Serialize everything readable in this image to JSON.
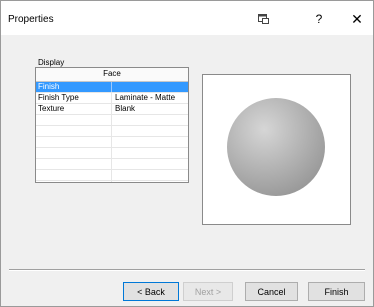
{
  "window": {
    "title": "Properties"
  },
  "titlebar": {
    "help_glyph": "?",
    "close_glyph": "✕"
  },
  "display": {
    "label": "Display",
    "column_header": "Face",
    "rows": [
      {
        "name": "Finish",
        "value": "",
        "selected": true
      },
      {
        "name": "Finish Type",
        "value": "Laminate - Matte",
        "selected": false
      },
      {
        "name": "Texture",
        "value": "Blank",
        "selected": false
      },
      {
        "name": "",
        "value": "",
        "selected": false
      },
      {
        "name": "",
        "value": "",
        "selected": false
      },
      {
        "name": "",
        "value": "",
        "selected": false
      },
      {
        "name": "",
        "value": "",
        "selected": false
      },
      {
        "name": "",
        "value": "",
        "selected": false
      },
      {
        "name": "",
        "value": "",
        "selected": false
      },
      {
        "name": "",
        "value": "",
        "selected": false
      }
    ]
  },
  "preview": {
    "shape": "sphere",
    "color": "#9a9a9a",
    "highlight": "#d6d6d6"
  },
  "buttons": {
    "back": "< Back",
    "next": "Next >",
    "cancel": "Cancel",
    "finish": "Finish"
  },
  "icons": {
    "pin": "pin-icon",
    "help": "help-icon",
    "close": "close-icon"
  }
}
